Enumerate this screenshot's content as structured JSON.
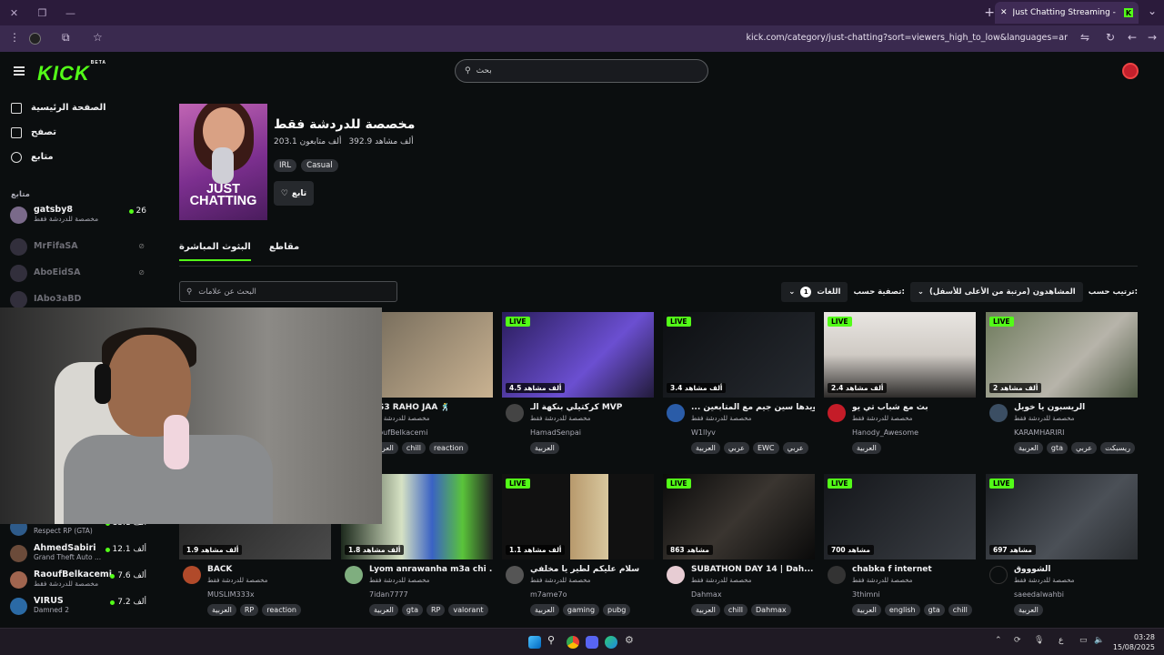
{
  "browser": {
    "tab_title": "Just Chatting Streaming - Live",
    "url": "kick.com/category/just-chatting?sort=viewers_high_to_low&languages=ar"
  },
  "header": {
    "logo": "KICK",
    "logo_badge": "BETA",
    "search_placeholder": "بحث"
  },
  "sidebar": {
    "nav": [
      {
        "label": "الصفحة الرئيسية",
        "icon": "home-icon"
      },
      {
        "label": "تصفح",
        "icon": "browse-icon"
      },
      {
        "label": "متابع",
        "icon": "heart-icon"
      }
    ],
    "following_title": "متابع",
    "channels": [
      {
        "name": "gatsby8",
        "sub": "مخصصة للدردشة فقط",
        "count": "26",
        "live": true
      },
      {
        "name": "MrFifaSA",
        "sub": "",
        "count": "",
        "live": false
      },
      {
        "name": "AboEidSA",
        "sub": "",
        "count": "",
        "live": false
      },
      {
        "name": "IAbo3aBD",
        "sub": "",
        "count": "",
        "live": false
      },
      {
        "name": "Peerless",
        "sub": "Respect RP (GTA)",
        "count": "13.1 ألف",
        "live": true
      },
      {
        "name": "AhmedSabiri",
        "sub": "Grand Theft Auto ...",
        "count": "12.1 ألف",
        "live": true
      },
      {
        "name": "RaoufBelkacemi",
        "sub": "مخصصة للدردشة فقط",
        "count": "7.6 ألف",
        "live": true
      },
      {
        "name": "VIRUS",
        "sub": "Damned 2",
        "count": "7.2 ألف",
        "live": true
      }
    ]
  },
  "category": {
    "thumb_title": "JUST CHATTING",
    "title": "مخصصة للدردشة فقط",
    "followers": "203.1 ألف متابعون",
    "viewers": "392.9 ألف مشاهد",
    "tags": [
      "IRL",
      "Casual"
    ],
    "follow_label": "تابع",
    "tabs": [
      "البثوث المباشرة",
      "مقاطع"
    ],
    "tag_search_placeholder": "البحث عن علامات",
    "sort_label": "ترتيب حسب:",
    "sort_value": "المشاهدون (مرتبة من الأعلى للأسفل)",
    "filter_label": "تصفية حسب:",
    "filter_value": "اللغات",
    "filter_count": "1"
  },
  "streams_row1": [
    {
      "title": "WS3 RAHO JAA 🕺",
      "category": "مخصصة للدردشة فقط",
      "name": "RaoufBelkacemi",
      "viewers": "",
      "tags": [
        "العربية",
        "chill",
        "reaction"
      ],
      "live": false
    },
    {
      "title": "كركتيلي بنكهة الـ MVP",
      "category": "مخصصة للدردشة فقط",
      "name": "HamadSenpai",
      "viewers": "4.5 ألف مشاهد",
      "tags": [
        "العربية"
      ],
      "live": true
    },
    {
      "title": "... الدوري ويدها سين جيم مع المتابعين",
      "category": "مخصصة للدردشة فقط",
      "name": "W1llyv",
      "viewers": "3.4 ألف مشاهد",
      "tags": [
        "العربية",
        "عربي",
        "EWC",
        "عربي"
      ],
      "live": true
    },
    {
      "title": "بث مع شباب تي يو",
      "category": "مخصصة للدردشة فقط",
      "name": "Hanody_Awesome",
      "viewers": "2.4 ألف مشاهد",
      "tags": [
        "العربية"
      ],
      "live": true
    },
    {
      "title": "الريسبون يا خويل",
      "category": "مخصصة للدردشة فقط",
      "name": "KARAMHARIRI",
      "viewers": "2 ألف مشاهد",
      "tags": [
        "العربية",
        "gta",
        "عربي",
        "ريسبكت"
      ],
      "live": true
    }
  ],
  "streams_row2": [
    {
      "title": "BACK",
      "category": "مخصصة للدردشة فقط",
      "name": "MUSLIM333x",
      "viewers": "1.9 ألف مشاهد",
      "tags": [
        "العربية",
        "RP",
        "reaction"
      ],
      "live": false
    },
    {
      "title": "Lyom anrawanha m3a chi ...",
      "category": "مخصصة للدردشة فقط",
      "name": "7idan7777",
      "viewers": "1.8 ألف مشاهد",
      "tags": [
        "العربية",
        "gta",
        "RP",
        "valorant"
      ],
      "live": false
    },
    {
      "title": "سلام عليكم لطير يا مخلفي",
      "category": "مخصصة للدردشة فقط",
      "name": "m7ame7o",
      "viewers": "1.1 ألف مشاهد",
      "tags": [
        "العربية",
        "gaming",
        "pubg"
      ],
      "live": true
    },
    {
      "title": "SUBATHON DAY 14 | Dah...",
      "category": "مخصصة للدردشة فقط",
      "name": "Dahmax",
      "viewers": "863 مشاهد",
      "tags": [
        "العربية",
        "chill",
        "Dahmax"
      ],
      "live": true
    },
    {
      "title": "chabka f internet",
      "category": "مخصصة للدردشة فقط",
      "name": "3thimni",
      "viewers": "700 مشاهد",
      "tags": [
        "العربية",
        "english",
        "gta",
        "chill"
      ],
      "live": true
    },
    {
      "title": "الشوووق",
      "category": "مخصصة للدردشة فقط",
      "name": "saeedalwahbi",
      "viewers": "697 مشاهد",
      "tags": [
        "العربية"
      ],
      "live": true
    }
  ],
  "taskbar": {
    "time": "03:28",
    "date": "15/08/2025",
    "lang": "ع"
  }
}
